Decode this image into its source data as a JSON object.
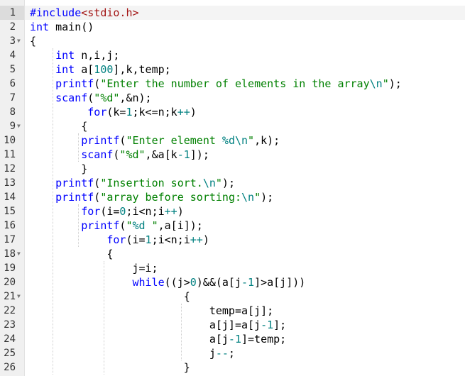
{
  "editor": {
    "colors": {
      "keyword": "#0000ff",
      "header": "#a31515",
      "string": "#008000",
      "number": "#008080",
      "gutter": "#f0f0f0",
      "active_line": "#f4f4f4"
    },
    "active_line": 1,
    "lines": [
      {
        "number": "1",
        "indent": 0,
        "fold": false,
        "tokens": [
          [
            "#include",
            "directive"
          ],
          [
            "<stdio.h>",
            "header"
          ]
        ]
      },
      {
        "number": "2",
        "indent": 0,
        "fold": false,
        "tokens": [
          [
            "int",
            "keyword"
          ],
          [
            " main()",
            "text"
          ]
        ]
      },
      {
        "number": "3",
        "indent": 0,
        "fold": true,
        "tokens": [
          [
            "{",
            "text"
          ]
        ]
      },
      {
        "number": "4",
        "indent": 4,
        "fold": false,
        "tokens": [
          [
            "int",
            "keyword"
          ],
          [
            " n,i,j;",
            "text"
          ]
        ]
      },
      {
        "number": "5",
        "indent": 4,
        "fold": false,
        "tokens": [
          [
            "int",
            "keyword"
          ],
          [
            " a[",
            "text"
          ],
          [
            "100",
            "number"
          ],
          [
            "],k,temp;",
            "text"
          ]
        ]
      },
      {
        "number": "6",
        "indent": 4,
        "fold": false,
        "tokens": [
          [
            "printf",
            "function"
          ],
          [
            "(",
            "text"
          ],
          [
            "\"Enter the number of elements in the array",
            "string"
          ],
          [
            "\\n",
            "escape"
          ],
          [
            "\"",
            "string"
          ],
          [
            ");",
            "text"
          ]
        ]
      },
      {
        "number": "7",
        "indent": 4,
        "fold": false,
        "tokens": [
          [
            "scanf",
            "function"
          ],
          [
            "(",
            "text"
          ],
          [
            "\"%d\"",
            "string"
          ],
          [
            ",&n);",
            "text"
          ]
        ]
      },
      {
        "number": "8",
        "indent": 9,
        "fold": false,
        "tokens": [
          [
            "for",
            "keyword"
          ],
          [
            "(k=",
            "text"
          ],
          [
            "1",
            "number"
          ],
          [
            ";k<=n;k",
            "text"
          ],
          [
            "++",
            "operator"
          ],
          [
            ")",
            "text"
          ]
        ]
      },
      {
        "number": "9",
        "indent": 8,
        "fold": true,
        "tokens": [
          [
            "{",
            "text"
          ]
        ]
      },
      {
        "number": "10",
        "indent": 8,
        "fold": false,
        "tokens": [
          [
            "printf",
            "function"
          ],
          [
            "(",
            "text"
          ],
          [
            "\"Enter element ",
            "string"
          ],
          [
            "%d",
            "format"
          ],
          [
            "\\n",
            "escape"
          ],
          [
            "\"",
            "string"
          ],
          [
            ",k);",
            "text"
          ]
        ]
      },
      {
        "number": "11",
        "indent": 8,
        "fold": false,
        "tokens": [
          [
            "scanf",
            "function"
          ],
          [
            "(",
            "text"
          ],
          [
            "\"%d\"",
            "string"
          ],
          [
            ",&a[k",
            "text"
          ],
          [
            "-",
            "operator"
          ],
          [
            "1",
            "number"
          ],
          [
            "]);",
            "text"
          ]
        ]
      },
      {
        "number": "12",
        "indent": 8,
        "fold": false,
        "tokens": [
          [
            "}",
            "text"
          ]
        ]
      },
      {
        "number": "13",
        "indent": 4,
        "fold": false,
        "tokens": [
          [
            "printf",
            "function"
          ],
          [
            "(",
            "text"
          ],
          [
            "\"Insertion sort.",
            "string"
          ],
          [
            "\\n",
            "escape"
          ],
          [
            "\"",
            "string"
          ],
          [
            ");",
            "text"
          ]
        ]
      },
      {
        "number": "14",
        "indent": 4,
        "fold": false,
        "tokens": [
          [
            "printf",
            "function"
          ],
          [
            "(",
            "text"
          ],
          [
            "\"array before sorting:",
            "string"
          ],
          [
            "\\n",
            "escape"
          ],
          [
            "\"",
            "string"
          ],
          [
            ");",
            "text"
          ]
        ]
      },
      {
        "number": "15",
        "indent": 8,
        "fold": false,
        "tokens": [
          [
            "for",
            "keyword"
          ],
          [
            "(i=",
            "text"
          ],
          [
            "0",
            "number"
          ],
          [
            ";i<n;i",
            "text"
          ],
          [
            "++",
            "operator"
          ],
          [
            ")",
            "text"
          ]
        ]
      },
      {
        "number": "16",
        "indent": 8,
        "fold": false,
        "tokens": [
          [
            "printf",
            "function"
          ],
          [
            "(",
            "text"
          ],
          [
            "\"",
            "string"
          ],
          [
            "%d",
            "format"
          ],
          [
            " \"",
            "string"
          ],
          [
            ",a[i]);",
            "text"
          ]
        ]
      },
      {
        "number": "17",
        "indent": 12,
        "fold": false,
        "tokens": [
          [
            "for",
            "keyword"
          ],
          [
            "(i=",
            "text"
          ],
          [
            "1",
            "number"
          ],
          [
            ";i<n;i",
            "text"
          ],
          [
            "++",
            "operator"
          ],
          [
            ")",
            "text"
          ]
        ]
      },
      {
        "number": "18",
        "indent": 12,
        "fold": true,
        "tokens": [
          [
            "{",
            "text"
          ]
        ]
      },
      {
        "number": "19",
        "indent": 16,
        "fold": false,
        "tokens": [
          [
            "j=i;",
            "text"
          ]
        ]
      },
      {
        "number": "20",
        "indent": 16,
        "fold": false,
        "tokens": [
          [
            "while",
            "keyword"
          ],
          [
            "((j>",
            "text"
          ],
          [
            "0",
            "number"
          ],
          [
            ")&&(a[j",
            "text"
          ],
          [
            "-",
            "operator"
          ],
          [
            "1",
            "number"
          ],
          [
            "]>a[j]))",
            "text"
          ]
        ]
      },
      {
        "number": "21",
        "indent": 24,
        "fold": true,
        "tokens": [
          [
            "{",
            "text"
          ]
        ]
      },
      {
        "number": "22",
        "indent": 28,
        "fold": false,
        "tokens": [
          [
            "temp=a[j];",
            "text"
          ]
        ]
      },
      {
        "number": "23",
        "indent": 28,
        "fold": false,
        "tokens": [
          [
            "a[j]=a[j",
            "text"
          ],
          [
            "-",
            "operator"
          ],
          [
            "1",
            "number"
          ],
          [
            "];",
            "text"
          ]
        ]
      },
      {
        "number": "24",
        "indent": 28,
        "fold": false,
        "tokens": [
          [
            "a[j",
            "text"
          ],
          [
            "-",
            "operator"
          ],
          [
            "1",
            "number"
          ],
          [
            "]=temp;",
            "text"
          ]
        ]
      },
      {
        "number": "25",
        "indent": 28,
        "fold": false,
        "tokens": [
          [
            "j",
            "text"
          ],
          [
            "--",
            "operator"
          ],
          [
            ";",
            "text"
          ]
        ]
      },
      {
        "number": "26",
        "indent": 24,
        "fold": false,
        "tokens": [
          [
            "}",
            "text"
          ]
        ]
      }
    ]
  }
}
